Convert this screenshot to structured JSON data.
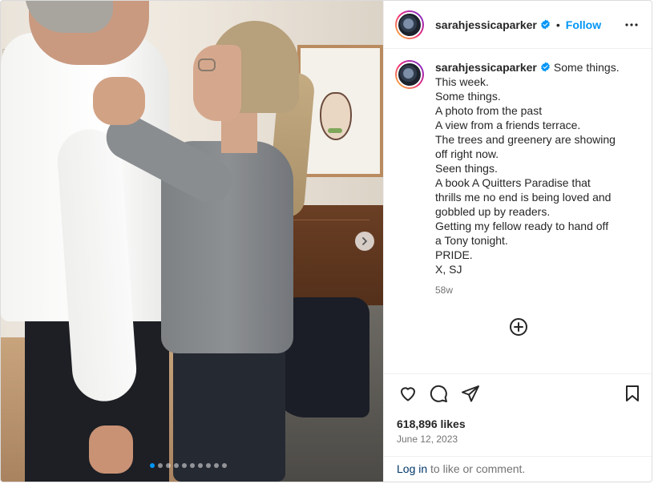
{
  "post": {
    "username": "sarahjessicaparker",
    "follow_label": "Follow",
    "separator": "•",
    "caption_lines": [
      "Some things.",
      "This week.",
      "Some things.",
      "A photo from the past",
      "A view from a friends terrace.",
      "The trees and greenery are showing",
      "off right now.",
      "Seen things.",
      "A book A Quitters Paradise that",
      "thrills me no end is being loved and",
      "gobbled up by readers.",
      "Getting my fellow ready to hand off",
      "a Tony tonight.",
      "PRIDE.",
      "X, SJ"
    ],
    "time_ago": "58w",
    "likes": "618,896 likes",
    "date": "June 12, 2023",
    "login_link": "Log in",
    "login_suffix": " to like or comment."
  },
  "carousel": {
    "slide_count": 10,
    "active_index": 0
  },
  "icons": {
    "verified": "verified-badge-icon",
    "more": "more-options-icon",
    "next": "chevron-right-icon",
    "add_comment": "add-comment-icon",
    "like": "heart-icon",
    "comment": "comment-icon",
    "share": "share-icon",
    "save": "bookmark-icon"
  },
  "colors": {
    "accent": "#0095f6",
    "text": "#262626",
    "muted": "#737373",
    "link": "#00376b"
  }
}
